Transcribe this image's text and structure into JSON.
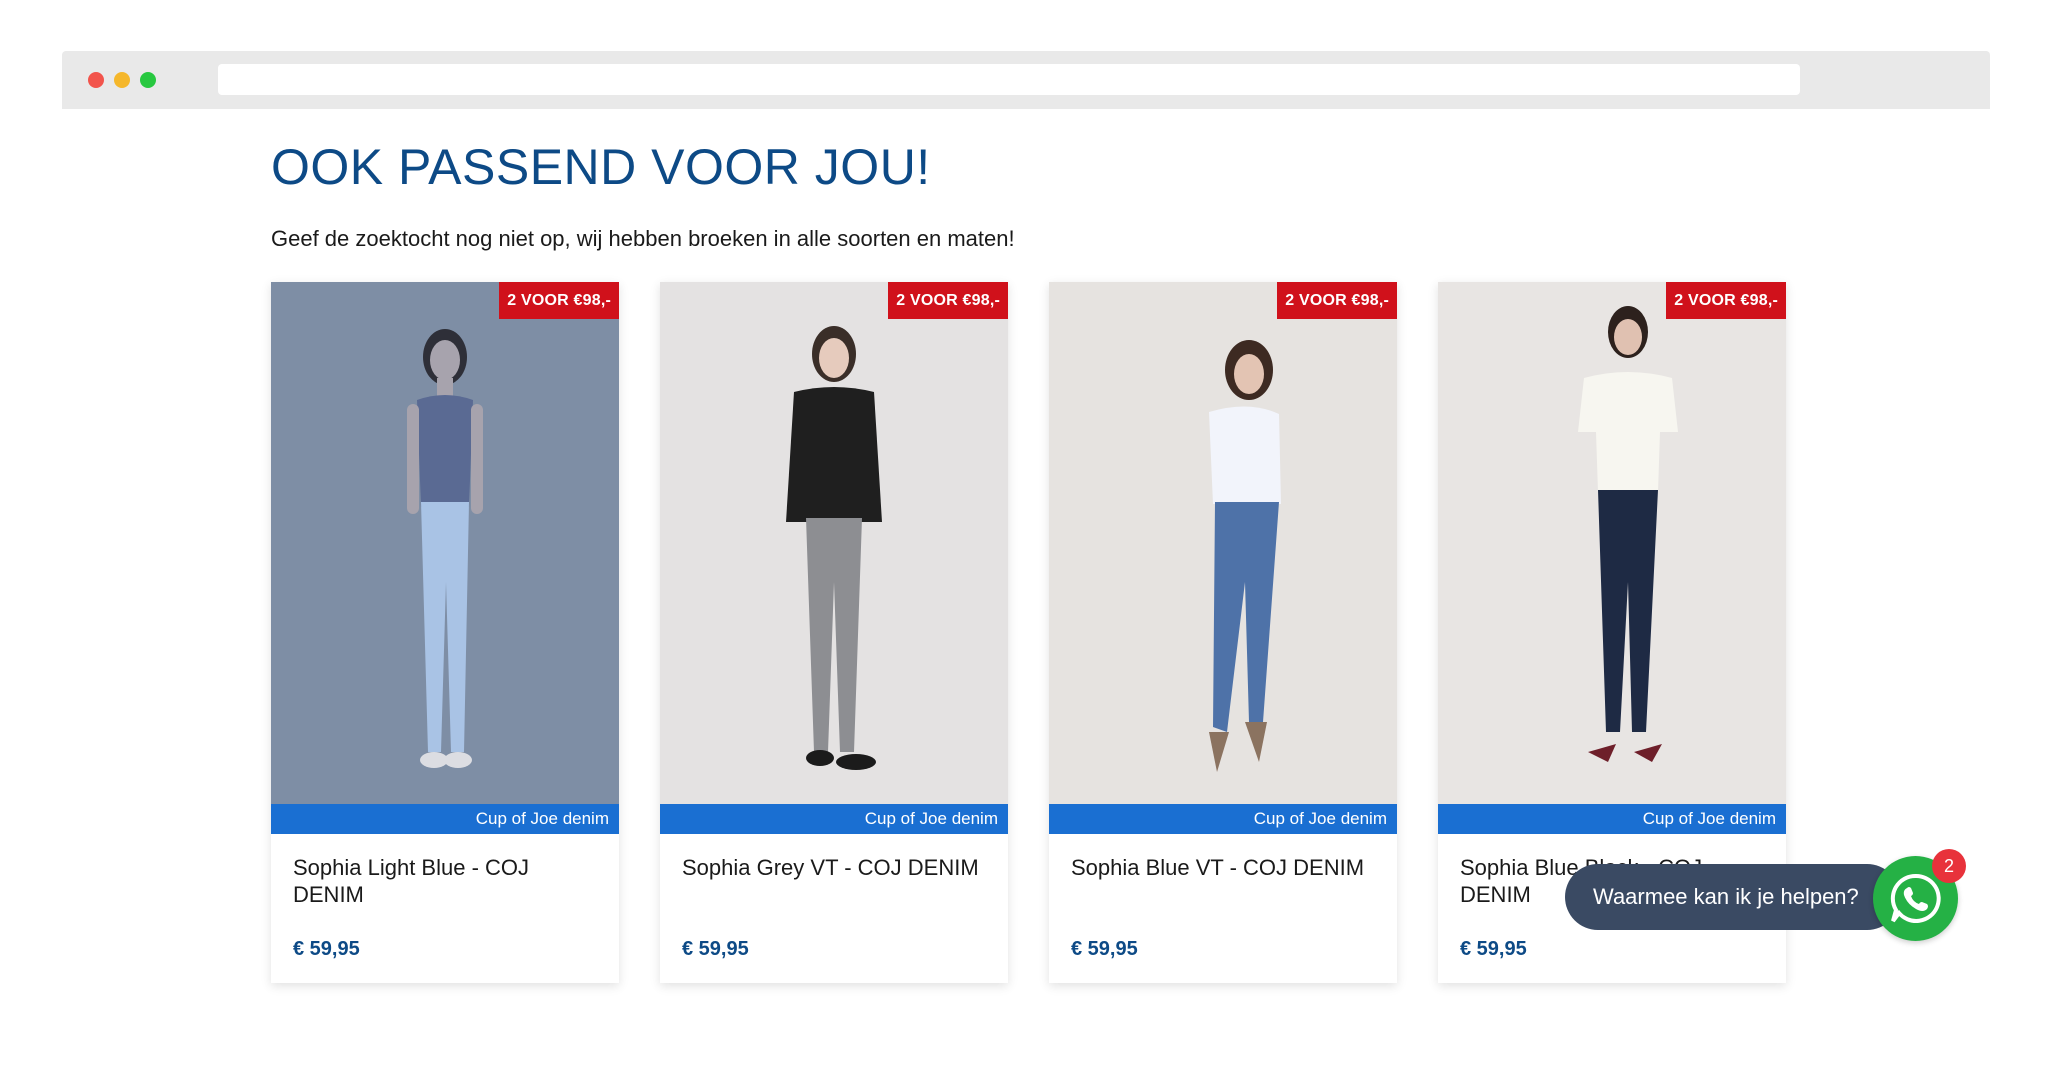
{
  "page": {
    "title": "OOK PASSEND VOOR JOU!",
    "subtitle": "Geef de zoektocht nog niet op, wij hebben broeken in alle soorten en maten!"
  },
  "products": [
    {
      "badge": "2 VOOR €98,-",
      "brand": "Cup of Joe denim",
      "name": "Sophia Light Blue - COJ DENIM",
      "price": "€ 59,95",
      "image": "model-light-blue-jeans"
    },
    {
      "badge": "2 VOOR €98,-",
      "brand": "Cup of Joe denim",
      "name": "Sophia Grey VT - COJ DENIM",
      "price": "€ 59,95",
      "image": "model-grey-jeans"
    },
    {
      "badge": "2 VOOR €98,-",
      "brand": "Cup of Joe denim",
      "name": "Sophia Blue VT - COJ DENIM",
      "price": "€ 59,95",
      "image": "model-blue-jeans"
    },
    {
      "badge": "2 VOOR €98,-",
      "brand": "Cup of Joe denim",
      "name": "Sophia Blue Black - COJ DENIM",
      "price": "€ 59,95",
      "image": "model-blue-black-jeans"
    }
  ],
  "chat": {
    "prompt": "Waarmee kan ik je helpen?",
    "unread_count": "2",
    "icon": "whatsapp-icon"
  },
  "colors": {
    "title": "#0d4a86",
    "badge": "#d0111b",
    "brand_strip": "#1a6fd2",
    "price": "#0d4a86",
    "chat_pill": "#3a4a63",
    "whatsapp": "#25b145"
  }
}
